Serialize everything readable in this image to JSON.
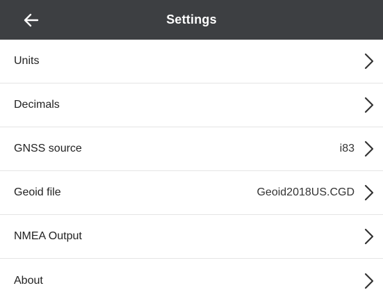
{
  "header": {
    "title": "Settings",
    "back_icon": "arrow-left-icon",
    "background": "#3d3f42"
  },
  "settings": {
    "items": [
      {
        "label": "Units",
        "value": "",
        "icon": "chevron-right-icon"
      },
      {
        "label": "Decimals",
        "value": "",
        "icon": "chevron-right-icon"
      },
      {
        "label": "GNSS source",
        "value": "i83",
        "icon": "chevron-right-icon"
      },
      {
        "label": "Geoid file",
        "value": "Geoid2018US.CGD",
        "icon": "chevron-right-icon"
      },
      {
        "label": "NMEA Output",
        "value": "",
        "icon": "chevron-right-icon"
      },
      {
        "label": "About",
        "value": "",
        "icon": "chevron-right-icon"
      }
    ]
  }
}
